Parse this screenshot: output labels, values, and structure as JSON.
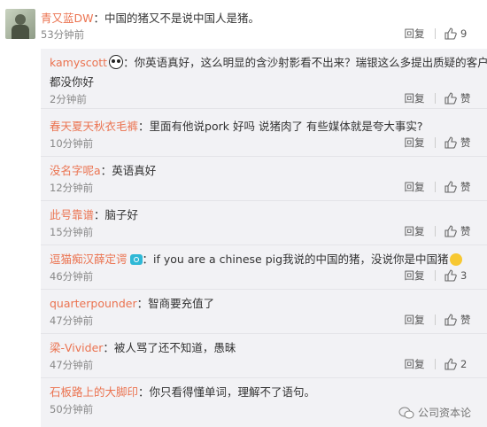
{
  "main_comment": {
    "user": "青又蓝DW",
    "sep": "：",
    "text": "中国的猪又不是说中国人是猪。",
    "time": "53分钟前",
    "reply_label": "回复",
    "likes": "9"
  },
  "replies": [
    {
      "user": "kamyscott",
      "badge": "panda-emoji",
      "sep": "：",
      "text": "你英语真好，这么明显的含沙射影看不出来？瑞银这么多提出质疑的客户英语",
      "text2": "都没你好",
      "time": "2分钟前",
      "reply_label": "回复",
      "likes": "赞"
    },
    {
      "user": "春天夏天秋衣毛裤",
      "sep": "：",
      "text": "里面有他说pork 好吗  说猪肉了  有些媒体就是夸大事实?",
      "time": "10分钟前",
      "reply_label": "回复",
      "likes": "赞"
    },
    {
      "user": "没名字呢a",
      "sep": "：",
      "text": "英语真好",
      "time": "12分钟前",
      "reply_label": "回复",
      "likes": "赞"
    },
    {
      "user": "此号靠谱",
      "sep": "：",
      "text": "脑子好",
      "time": "15分钟前",
      "reply_label": "回复",
      "likes": "赞"
    },
    {
      "user": "逗猫痴汉薛定谔",
      "badge": "vip-badge",
      "sep": "：",
      "text": "if you are a chinese pig我说的中国的猪，没说你是中国猪",
      "time": "46分钟前",
      "reply_label": "回复",
      "likes": "3"
    },
    {
      "user": "quarterpounder",
      "sep": "：",
      "text": "智商要充值了",
      "time": "47分钟前",
      "reply_label": "回复",
      "likes": "赞"
    },
    {
      "user": "梁-Vivider",
      "sep": "：",
      "text": "被人骂了还不知道，愚昧",
      "time": "47分钟前",
      "reply_label": "回复",
      "likes": "2"
    },
    {
      "user": "石板路上的大脚印",
      "sep": "：",
      "text": "你只看得懂单词，理解不了语句。",
      "time": "50分钟前",
      "reply_label": "回复",
      "likes": "赞"
    }
  ],
  "watermark": "公司资本论",
  "colors": {
    "username": "#eb7350",
    "reply_bg": "#f2f2f5",
    "time": "#888888"
  }
}
